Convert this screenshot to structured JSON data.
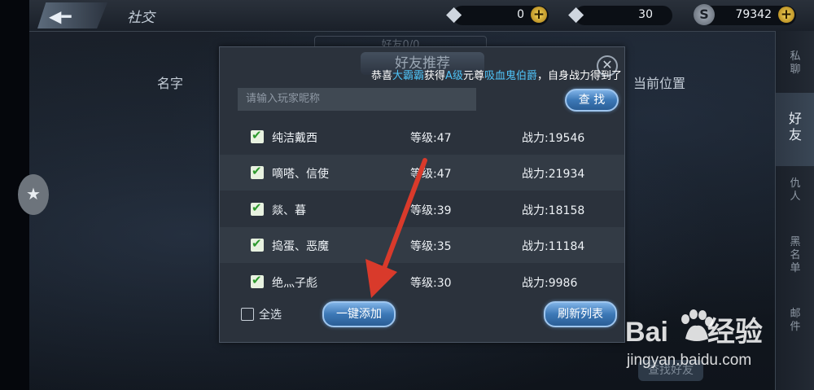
{
  "topbar": {
    "title": "社交",
    "diamond_value": "0",
    "diamond2_value": "30",
    "coin_value": "79342",
    "plus": "+",
    "coin_symbol": "S"
  },
  "background": {
    "under_tab_label": "好友0/0",
    "col_name": "名字",
    "col_location": "当前位置",
    "find_friend_button": "查找好友"
  },
  "right_tabs": [
    {
      "label": "私聊",
      "active": false
    },
    {
      "label": "好友",
      "active": true
    },
    {
      "label": "仇人",
      "active": false
    },
    {
      "label": "黑名单",
      "active": false
    },
    {
      "label": "邮件",
      "active": false
    }
  ],
  "dialog": {
    "title": "好友推荐",
    "close": "✕",
    "marquee": {
      "prefix": "恭喜",
      "player": "大霸霸",
      "mid1": "获得",
      "grade": "A级",
      "mid2": "元尊",
      "item": "吸血鬼伯爵",
      "suffix": "，自身战力得到了巨"
    },
    "search_placeholder": "请输入玩家昵称",
    "search_button": "查 找",
    "select_all": "全选",
    "add_all_button": "一键添加",
    "refresh_button": "刷新列表",
    "rows": [
      {
        "name": "纯洁戴西",
        "level": "等级:47",
        "power": "战力:19546",
        "checked": true
      },
      {
        "name": "嘀嗒、信使",
        "level": "等级:47",
        "power": "战力:21934",
        "checked": true
      },
      {
        "name": "燚、暮",
        "level": "等级:39",
        "power": "战力:18158",
        "checked": true
      },
      {
        "name": "捣蛋、恶魔",
        "level": "等级:35",
        "power": "战力:11184",
        "checked": true
      },
      {
        "name": "绝灬子彪",
        "level": "等级:30",
        "power": "战力:9986",
        "checked": true
      }
    ]
  },
  "watermark": {
    "brand_left": "Bai",
    "brand_right": "经验",
    "url": "jingyan.baidu.com"
  },
  "colors": {
    "highlight": "#4fc3f7",
    "arrow": "#d93a2b",
    "checkbox": "#2e9a2e"
  }
}
